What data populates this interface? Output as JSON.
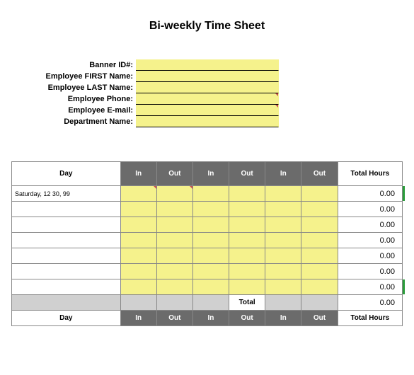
{
  "title": "Bi-weekly Time Sheet",
  "info": {
    "banner_id_label": "Banner ID#:",
    "first_name_label": "Employee FIRST Name:",
    "last_name_label": "Employee LAST Name:",
    "phone_label": "Employee Phone:",
    "email_label": "Employee E-mail:",
    "dept_label": "Department Name:",
    "banner_id": "",
    "first_name": "",
    "last_name": "",
    "phone": "",
    "email": "",
    "dept": ""
  },
  "headers": {
    "day": "Day",
    "in": "In",
    "out": "Out",
    "total_hours": "Total Hours"
  },
  "rows": [
    {
      "day": "Saturday, 12 30, 99",
      "in1": "",
      "out1": "",
      "in2": "",
      "out2": "",
      "in3": "",
      "out3": "",
      "total": "0.00"
    },
    {
      "day": "",
      "in1": "",
      "out1": "",
      "in2": "",
      "out2": "",
      "in3": "",
      "out3": "",
      "total": "0.00"
    },
    {
      "day": "",
      "in1": "",
      "out1": "",
      "in2": "",
      "out2": "",
      "in3": "",
      "out3": "",
      "total": "0.00"
    },
    {
      "day": "",
      "in1": "",
      "out1": "",
      "in2": "",
      "out2": "",
      "in3": "",
      "out3": "",
      "total": "0.00"
    },
    {
      "day": "",
      "in1": "",
      "out1": "",
      "in2": "",
      "out2": "",
      "in3": "",
      "out3": "",
      "total": "0.00"
    },
    {
      "day": "",
      "in1": "",
      "out1": "",
      "in2": "",
      "out2": "",
      "in3": "",
      "out3": "",
      "total": "0.00"
    },
    {
      "day": "",
      "in1": "",
      "out1": "",
      "in2": "",
      "out2": "",
      "in3": "",
      "out3": "",
      "total": "0.00"
    }
  ],
  "total_label": "Total",
  "grand_total": "0.00"
}
